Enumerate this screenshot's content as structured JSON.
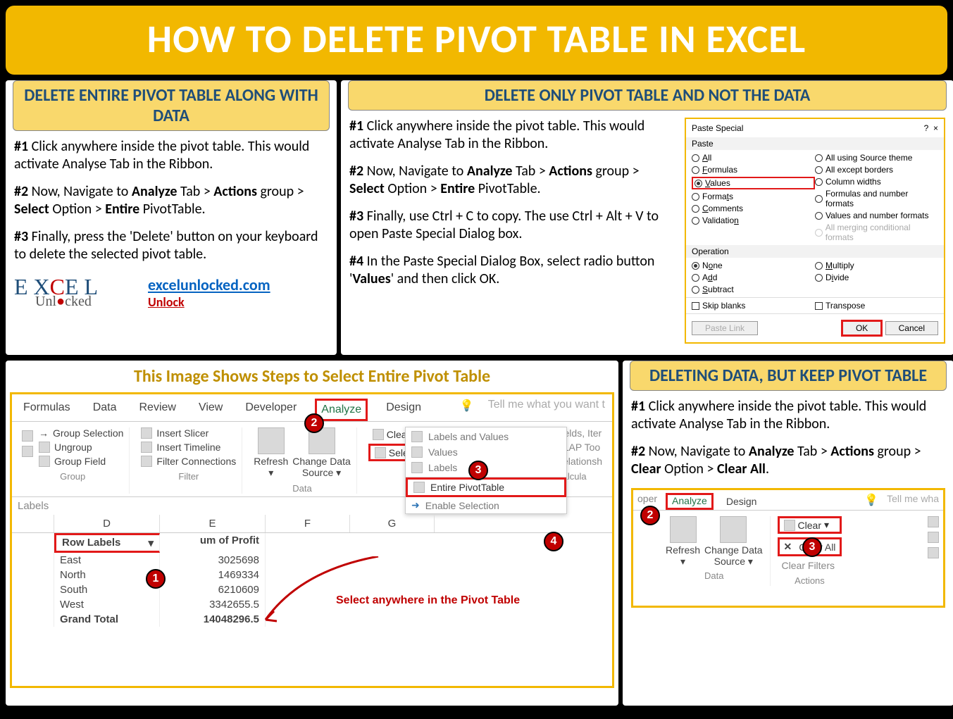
{
  "title": "HOW TO DELETE PIVOT TABLE IN EXCEL",
  "brand": {
    "link": "excelunlocked.com",
    "unlock": "Unlock"
  },
  "left_panel": {
    "heading": "DELETE ENTIRE PIVOT TABLE ALONG WITH DATA",
    "s1": {
      "num": "#1",
      "text": " Click anywhere inside the pivot table. This would activate Analyse Tab in the Ribbon."
    },
    "s2": {
      "num": "#2",
      "pre": " Now, Navigate to ",
      "b1": "Analyze",
      "mid1": " Tab > ",
      "b2": "Actions",
      "mid2": " group > ",
      "b3": "Select",
      "mid3": " Option > ",
      "b4": "Entire",
      "post": " PivotTable."
    },
    "s3": {
      "num": "#3",
      "text": " Finally, press the 'Delete' button on your keyboard to delete the selected pivot table."
    }
  },
  "right_panel": {
    "heading": "DELETE ONLY PIVOT TABLE AND NOT THE DATA",
    "s1": {
      "num": "#1",
      "text": " Click anywhere inside the pivot table. This would activate Analyse Tab in the Ribbon."
    },
    "s2": {
      "num": "#2",
      "pre": " Now, Navigate to ",
      "b1": "Analyze",
      "mid1": " Tab > ",
      "b2": "Actions",
      "mid2": " group > ",
      "b3": "Select",
      "mid3": " Option > ",
      "b4": "Entire",
      "post": " PivotTable."
    },
    "s3": {
      "num": "#3",
      "text": " Finally, use Ctrl + C to copy. The use Ctrl + Alt + V to open Paste Special Dialog box."
    },
    "s4": {
      "num": "#4",
      "pre": " In the Paste Special Dialog Box, select radio button '",
      "b1": "Values",
      "post": "' and then click OK."
    }
  },
  "paste_special": {
    "title": "Paste Special",
    "section_paste": "Paste",
    "paste_left": [
      "All",
      "Formulas",
      "Values",
      "Formats",
      "Comments",
      "Validation"
    ],
    "paste_right": [
      "All using Source theme",
      "All except borders",
      "Column widths",
      "Formulas and number formats",
      "Values and number formats",
      "All merging conditional formats"
    ],
    "section_op": "Operation",
    "op_left": [
      "None",
      "Add",
      "Subtract"
    ],
    "op_right": [
      "Multiply",
      "Divide"
    ],
    "skip": "Skip blanks",
    "transpose": "Transpose",
    "paste_link": "Paste Link",
    "ok": "OK",
    "cancel": "Cancel"
  },
  "bottom_left": {
    "caption": "This Image Shows Steps to Select Entire Pivot Table",
    "tabs": [
      "Formulas",
      "Data",
      "Review",
      "View",
      "Developer",
      "Analyze",
      "Design"
    ],
    "tell_me": "Tell me what you want t",
    "group_names": {
      "group": "Group",
      "filter": "Filter",
      "data": "Data",
      "calc": "Calcula"
    },
    "groups": {
      "group": [
        "Group Selection",
        "Ungroup",
        "Group Field"
      ],
      "filter": [
        "Insert Slicer",
        "Insert Timeline",
        "Filter Connections"
      ],
      "data": {
        "refresh": "Refresh",
        "change": "Change Data",
        "source": "Source"
      },
      "actions": {
        "clear": "Clear",
        "select": "Select"
      },
      "show": {
        "fields": "Fields, Iter",
        "olap": "OLAP Too",
        "rel": "Relationsh"
      }
    },
    "dropdown": [
      "Labels and Values",
      "Values",
      "Labels",
      "Entire PivotTable",
      "Enable Selection"
    ],
    "callout": "Select anywhere in the Pivot Table",
    "labels": "Labels",
    "cols": [
      "D",
      "E",
      "F",
      "G"
    ],
    "header_row": [
      "Row Labels",
      "um of Profit"
    ],
    "rows": [
      [
        "East",
        "3025698"
      ],
      [
        "North",
        "1469334"
      ],
      [
        "South",
        "6210609"
      ],
      [
        "West",
        "3342655.5"
      ],
      [
        "Grand Total",
        "14048296.5"
      ]
    ]
  },
  "bottom_right": {
    "heading": "DELETING DATA, BUT KEEP PIVOT TABLE",
    "s1": {
      "num": "#1",
      "text": " Click anywhere inside the pivot table. This would activate Analyse Tab in the Ribbon."
    },
    "s2": {
      "num": "#2",
      "pre": " Now, Navigate to ",
      "b1": "Analyze",
      "mid1": " Tab > ",
      "b2": "Actions",
      "mid2": " group > ",
      "b3": "Clear",
      "mid3": " Option > ",
      "b4": "Clear All",
      "post": "."
    },
    "ribbon": {
      "tabs_left": "oper",
      "tabs": [
        "Analyze",
        "Design"
      ],
      "tell_me": "Tell me wha",
      "data_group": {
        "refresh": "Refresh",
        "change": "Change Data",
        "source": "Source",
        "label": "Data"
      },
      "actions": {
        "clear": "Clear",
        "clear_all": "Clear All",
        "clear_filters": "Clear Filters",
        "label": "Actions"
      }
    }
  }
}
